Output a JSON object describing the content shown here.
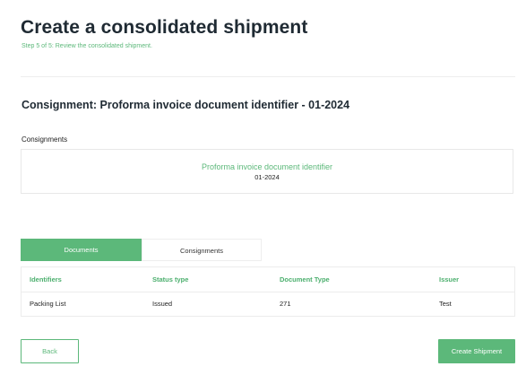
{
  "header": {
    "title": "Create a consolidated shipment",
    "step": "Step 5 of 5: Review the consolidated shipment."
  },
  "consignment": {
    "section_title": "Consignment: Proforma invoice document identifier - 01-2024",
    "list_label": "Consignments",
    "card": {
      "name": "Proforma invoice document identifier",
      "id": "01-2024"
    }
  },
  "tabs": [
    {
      "label": "Documents",
      "active": true
    },
    {
      "label": "Consignments",
      "active": false
    }
  ],
  "table": {
    "headers": [
      "Identifiers",
      "Status type",
      "Document Type",
      "Issuer"
    ],
    "rows": [
      [
        "Packing List",
        "Issued",
        "271",
        "Test"
      ]
    ]
  },
  "actions": {
    "back_label": "Back",
    "create_label": "Create Shipment"
  },
  "colors": {
    "accent": "#5cb87a",
    "title": "#1f2a33"
  }
}
